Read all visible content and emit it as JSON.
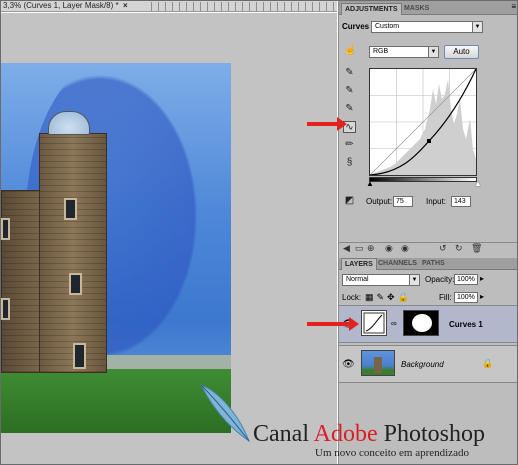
{
  "document": {
    "title": "3,3% (Curves 1, Layer Mask/8) *",
    "close_label": "×"
  },
  "adjustments": {
    "tabs": [
      "ADJUSTMENTS",
      "MASKS"
    ],
    "panel_label": "Curves",
    "preset": "Custom",
    "channel": "RGB",
    "auto_label": "Auto",
    "output_label": "Output:",
    "output_value": "75",
    "input_label": "Input:",
    "input_value": "143"
  },
  "layers": {
    "tabs": [
      "LAYERS",
      "CHANNELS",
      "PATHS"
    ],
    "blend_mode": "Normal",
    "opacity_label": "Opacity:",
    "opacity": "100%",
    "lock_label": "Lock:",
    "fill_label": "Fill:",
    "fill": "100%",
    "items": [
      {
        "name": "Curves 1"
      },
      {
        "name": "Background"
      }
    ]
  },
  "brand": {
    "part1": "Canal ",
    "part2": "Adobe",
    "part3": " Photoshop",
    "tagline": "Um novo conceito em aprendizado"
  },
  "colors": {
    "accent_red": "#e2221e",
    "adobe_red": "#d91f26"
  }
}
